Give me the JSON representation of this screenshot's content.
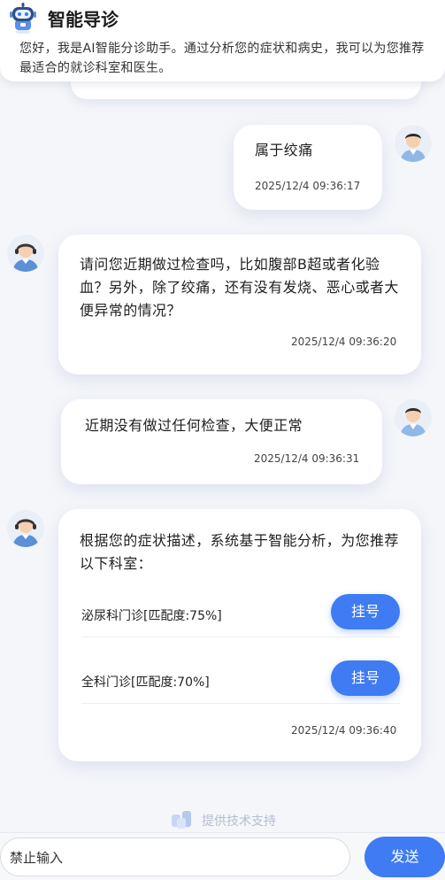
{
  "header": {
    "title": "智能导诊",
    "description": "您好，我是AI智能分诊助手。通过分析您的症状和病史，我可以为您推荐最适合的就诊科室和医生。"
  },
  "messages": [
    {
      "role": "user",
      "text": "属于绞痛",
      "time": "2025/12/4 09:36:17"
    },
    {
      "role": "bot",
      "text": "请问您近期做过检查吗，比如腹部B超或者化验血？另外，除了绞痛，还有没有发烧、恶心或者大便异常的情况？",
      "time": "2025/12/4 09:36:20"
    },
    {
      "role": "user",
      "text": "近期没有做过任何检查，大便正常",
      "time": "2025/12/4 09:36:31"
    },
    {
      "role": "bot",
      "text": "根据您的症状描述，系统基于智能分析，为您推荐以下科室：",
      "time": "2025/12/4 09:36:40",
      "recommendations": [
        {
          "name": "泌尿科门诊[匹配度:75%]",
          "button": "挂号"
        },
        {
          "name": "全科门诊[匹配度:70%]",
          "button": "挂号"
        }
      ]
    }
  ],
  "footer": {
    "support_text": "提供技术支持",
    "input_placeholder": "禁止输入",
    "send_label": "发送"
  },
  "colors": {
    "accent": "#3f7bf2",
    "background": "#f4f6f9"
  }
}
